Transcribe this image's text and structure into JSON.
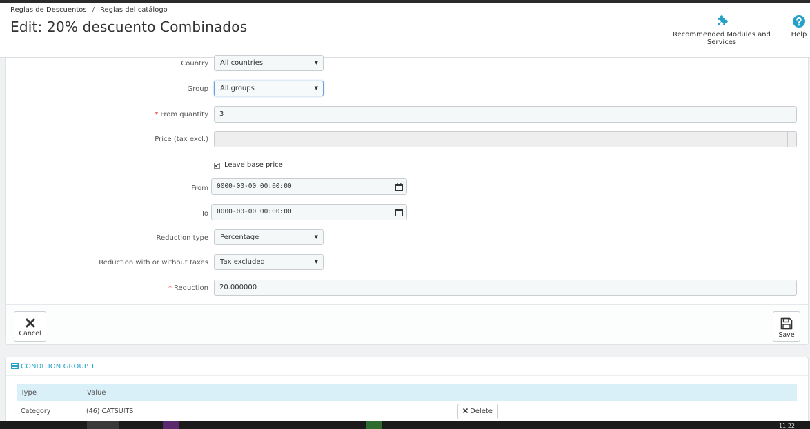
{
  "breadcrumb": {
    "item1": "Reglas de Descuentos",
    "separator": "/",
    "item2": "Reglas del catálogo"
  },
  "page_title": "Edit: 20% descuento Combinados",
  "toolbar": {
    "modules_label": "Recommended Modules and Services",
    "help_label": "Help"
  },
  "form": {
    "country": {
      "label": "Country",
      "value": "All countries"
    },
    "group": {
      "label": "Group",
      "value": "All groups"
    },
    "from_quantity": {
      "label": "From quantity",
      "value": "3"
    },
    "price": {
      "label": "Price (tax excl.)",
      "value": ""
    },
    "leave_base_price": {
      "label": "Leave base price",
      "checked": true
    },
    "from": {
      "label": "From",
      "value": "0000-00-00 00:00:00"
    },
    "to": {
      "label": "To",
      "value": "0000-00-00 00:00:00"
    },
    "reduction_type": {
      "label": "Reduction type",
      "value": "Percentage"
    },
    "reduction_tax": {
      "label": "Reduction with or without taxes",
      "value": "Tax excluded"
    },
    "reduction": {
      "label": "Reduction",
      "value": "20.000000"
    },
    "required_mark": "*",
    "caret": "▼",
    "check_mark": "✔"
  },
  "footer": {
    "cancel_label": "Cancel",
    "save_label": "Save"
  },
  "condition_group": {
    "title": "CONDITION GROUP 1",
    "columns": [
      "Type",
      "Value"
    ],
    "rows": [
      {
        "type": "Category",
        "value": "(46) CATSUITS",
        "delete_label": "Delete"
      }
    ]
  },
  "taskbar": {
    "clock": "11:22"
  },
  "colors": {
    "accent": "#25a1c8",
    "required": "#e02525",
    "table_header": "#d9f0f8"
  }
}
